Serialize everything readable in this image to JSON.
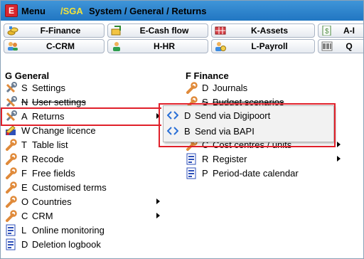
{
  "titlebar": {
    "logo_letter": "E",
    "menu": "Menu",
    "path_prefix": "/SGA",
    "path_rest": "System / General / Returns"
  },
  "toolbar": {
    "row1": [
      {
        "label": "F-Finance",
        "icon": "coins-icon"
      },
      {
        "label": "E-Cash flow",
        "icon": "cash-flow-icon"
      },
      {
        "label": "K-Assets",
        "icon": "assets-icon"
      },
      {
        "label": "A-I",
        "icon": "invoice-icon"
      }
    ],
    "row2": [
      {
        "label": "C-CRM",
        "icon": "crm-people-icon"
      },
      {
        "label": "H-HR",
        "icon": "hr-icon"
      },
      {
        "label": "L-Payroll",
        "icon": "payroll-icon"
      },
      {
        "label": "Q",
        "icon": "barcode-icon"
      }
    ]
  },
  "general": {
    "heading": "G General",
    "items": [
      {
        "key": "S",
        "label": "Settings",
        "icon": "tools-icon"
      },
      {
        "key": "N",
        "label": "User settings",
        "icon": "tools-icon"
      },
      {
        "key": "A",
        "label": "Returns",
        "icon": "tools-icon"
      },
      {
        "key": "W",
        "label": "Change licence",
        "icon": "licence-icon"
      },
      {
        "key": "T",
        "label": "Table list",
        "icon": "wrench-icon"
      },
      {
        "key": "R",
        "label": "Recode",
        "icon": "wrench-icon"
      },
      {
        "key": "F",
        "label": "Free fields",
        "icon": "wrench-icon"
      },
      {
        "key": "E",
        "label": "Customised terms",
        "icon": "wrench-icon"
      },
      {
        "key": "O",
        "label": "Countries",
        "icon": "wrench-icon"
      },
      {
        "key": "C",
        "label": "CRM",
        "icon": "wrench-icon"
      },
      {
        "key": "L",
        "label": "Online monitoring",
        "icon": "report-icon"
      },
      {
        "key": "D",
        "label": "Deletion logbook",
        "icon": "report-icon"
      }
    ]
  },
  "finance": {
    "heading": "F Finance",
    "items": [
      {
        "key": "D",
        "label": "Journals",
        "icon": "wrench-icon"
      },
      {
        "key": "S",
        "label": "Budget scenarios",
        "icon": "wrench-icon"
      },
      {
        "key": "C",
        "label": "Cost centres / units",
        "icon": "wrench-icon"
      },
      {
        "key": "R",
        "label": "Register",
        "icon": "report-icon"
      },
      {
        "key": "P",
        "label": "Period-date calendar",
        "icon": "report-icon"
      }
    ]
  },
  "popup": {
    "items": [
      {
        "key": "D",
        "label": "Send via Digipoort",
        "icon": "code-brackets-icon"
      },
      {
        "key": "B",
        "label": "Send via BAPI",
        "icon": "code-brackets-icon"
      }
    ]
  },
  "colors": {
    "titlebar": "#2b84cf",
    "highlight_box": "#e0202a",
    "path_prefix": "#f2e23a"
  }
}
